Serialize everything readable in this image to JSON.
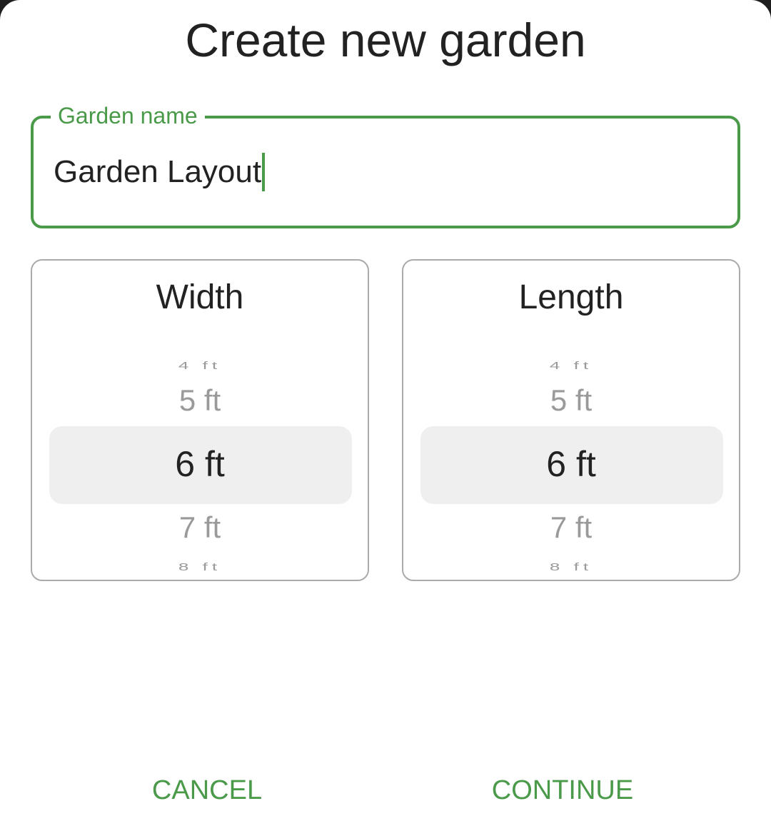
{
  "dialog": {
    "title": "Create new garden"
  },
  "name_field": {
    "label": "Garden name",
    "value": "Garden Layout"
  },
  "width_picker": {
    "title": "Width",
    "options": [
      "4 ft",
      "5 ft",
      "6 ft",
      "7 ft",
      "8 ft"
    ],
    "selected": "6 ft"
  },
  "length_picker": {
    "title": "Length",
    "options": [
      "4 ft",
      "5 ft",
      "6 ft",
      "7 ft",
      "8 ft"
    ],
    "selected": "6 ft"
  },
  "actions": {
    "cancel": "CANCEL",
    "continue": "CONTINUE"
  },
  "colors": {
    "accent": "#4a9a4a",
    "highlight": "#efefef"
  }
}
